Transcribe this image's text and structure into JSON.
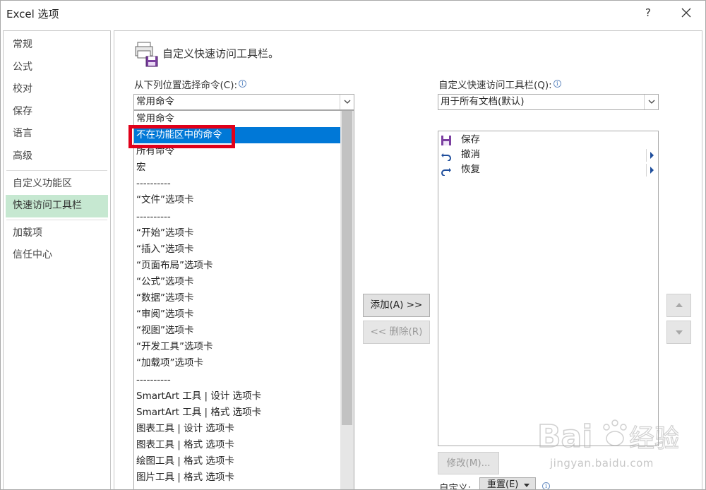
{
  "window": {
    "title": "Excel 选项",
    "help": "?"
  },
  "nav": {
    "items": [
      "常规",
      "公式",
      "校对",
      "保存",
      "语言",
      "高级"
    ],
    "items2": [
      "自定义功能区",
      "快速访问工具栏"
    ],
    "items3": [
      "加载项",
      "信任中心"
    ],
    "active": "快速访问工具栏"
  },
  "header": {
    "title": "自定义快速访问工具栏。"
  },
  "left_panel": {
    "label": "从下列位置选择命令(C):",
    "label_key": "C",
    "combo_value": "常用命令",
    "list": [
      "常用命令",
      "不在功能区中的命令",
      "所有命令",
      "宏",
      "----------",
      "“文件”选项卡",
      "----------",
      "“开始”选项卡",
      "“插入”选项卡",
      "“页面布局”选项卡",
      "“公式”选项卡",
      "“数据”选项卡",
      "“审阅”选项卡",
      "“视图”选项卡",
      "“开发工具”选项卡",
      "“加载项”选项卡",
      "----------",
      "SmartArt 工具 | 设计 选项卡",
      "SmartArt 工具 | 格式 选项卡",
      "图表工具 | 设计 选项卡",
      "图表工具 | 格式 选项卡",
      "绘图工具 | 格式 选项卡",
      "图片工具 | 格式 选项卡"
    ],
    "selected_index": 1
  },
  "buttons": {
    "add": "添加(A) >>",
    "remove": "<< 删除(R)",
    "modify": "修改(M)...",
    "reset": "重置(E)",
    "customize_label": "自定义:"
  },
  "right_panel": {
    "label": "自定义快速访问工具栏(Q):",
    "combo_value": "用于所有文档(默认)",
    "items": [
      {
        "label": "保存",
        "icon": "save-icon"
      },
      {
        "label": "撤消",
        "icon": "undo-icon"
      },
      {
        "label": "恢复",
        "icon": "redo-icon"
      }
    ]
  },
  "watermark": {
    "text": "jingyan.baidu.com"
  },
  "colors": {
    "selection": "#0078d7",
    "nav_active": "#c6e8d1",
    "highlight": "#e0001a"
  }
}
